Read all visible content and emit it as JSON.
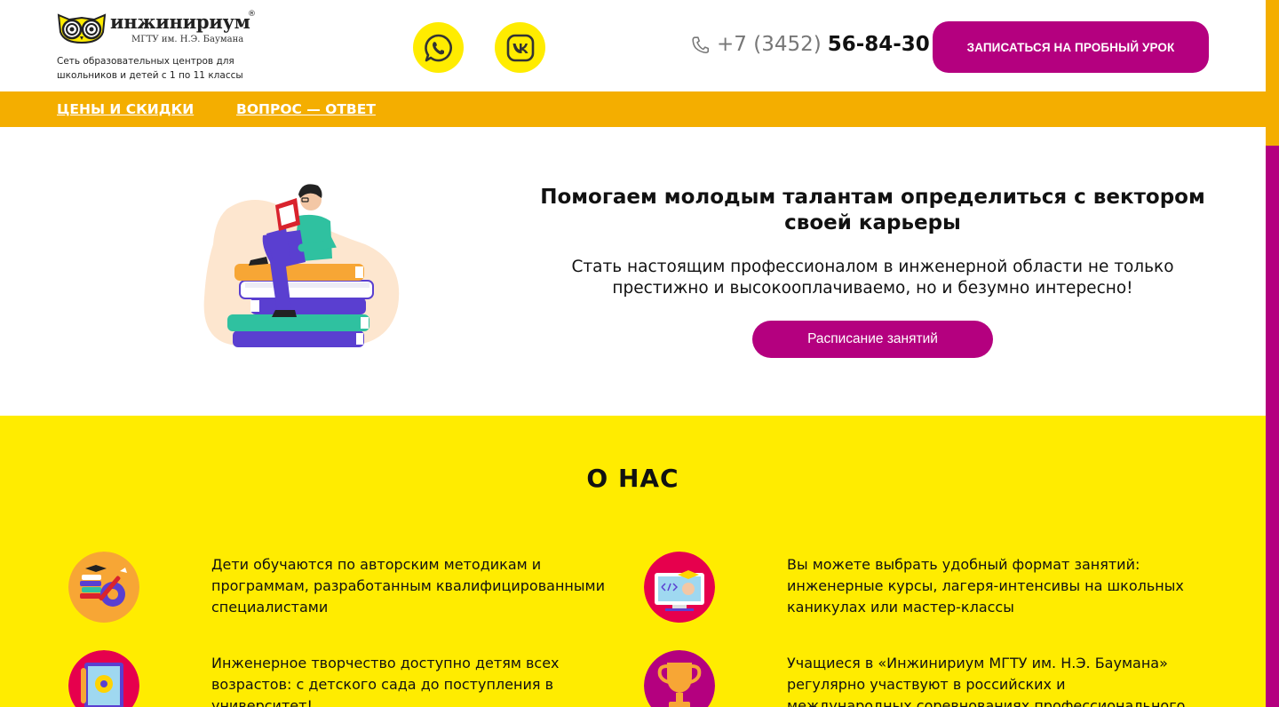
{
  "brand": {
    "name": "инжинириум",
    "registered": "®",
    "subtitle": "МГТУ им. Н.Э. Баумана",
    "tagline": "Сеть образовательных центров для школьников и детей с 1 по 11 классы"
  },
  "header": {
    "phone_code": "+7 (3452)",
    "phone_number": "56-84-30",
    "cta_label": "ЗАПИСАТЬСЯ НА ПРОБНЫЙ УРОК",
    "social": [
      "whatsapp-icon",
      "vk-icon"
    ]
  },
  "nav": {
    "items": [
      {
        "label": "ЦЕНЫ И СКИДКИ"
      },
      {
        "label": "ВОПРОС — ОТВЕТ"
      }
    ]
  },
  "hero": {
    "title": "Помогаем молодым талантам определиться с вектором своей карьеры",
    "text": "Стать настоящим профессионалом в инженерной области не только престижно и высокооплачиваемо, но и безумно интересно!",
    "button_label": "Расписание занятий"
  },
  "about": {
    "title": "О НАС",
    "features": [
      {
        "icon": "methodology-icon",
        "text": "Дети обучаются по авторским методикам и программам, разработанным квалифицированными специалистами"
      },
      {
        "icon": "online-class-icon",
        "text": "Вы можете выбрать удобный формат занятий: инженерные курсы, лагеря-интенсивы на школьных каникулах или мастер-классы"
      },
      {
        "icon": "engineering-blueprint-icon",
        "text": "Инженерное творчество доступно детям всех возрастов: с детского сада до поступления в университет!"
      },
      {
        "icon": "trophy-icon",
        "text": "Учащиеся в «Инжинириум МГТУ им. Н.Э. Баумана» регулярно участвуют в российских и международных соревнованиях профессионального мастерства"
      }
    ]
  },
  "colors": {
    "accent_magenta": "#b4007f",
    "accent_orange": "#f4ae00",
    "accent_yellow": "#ffec00"
  }
}
